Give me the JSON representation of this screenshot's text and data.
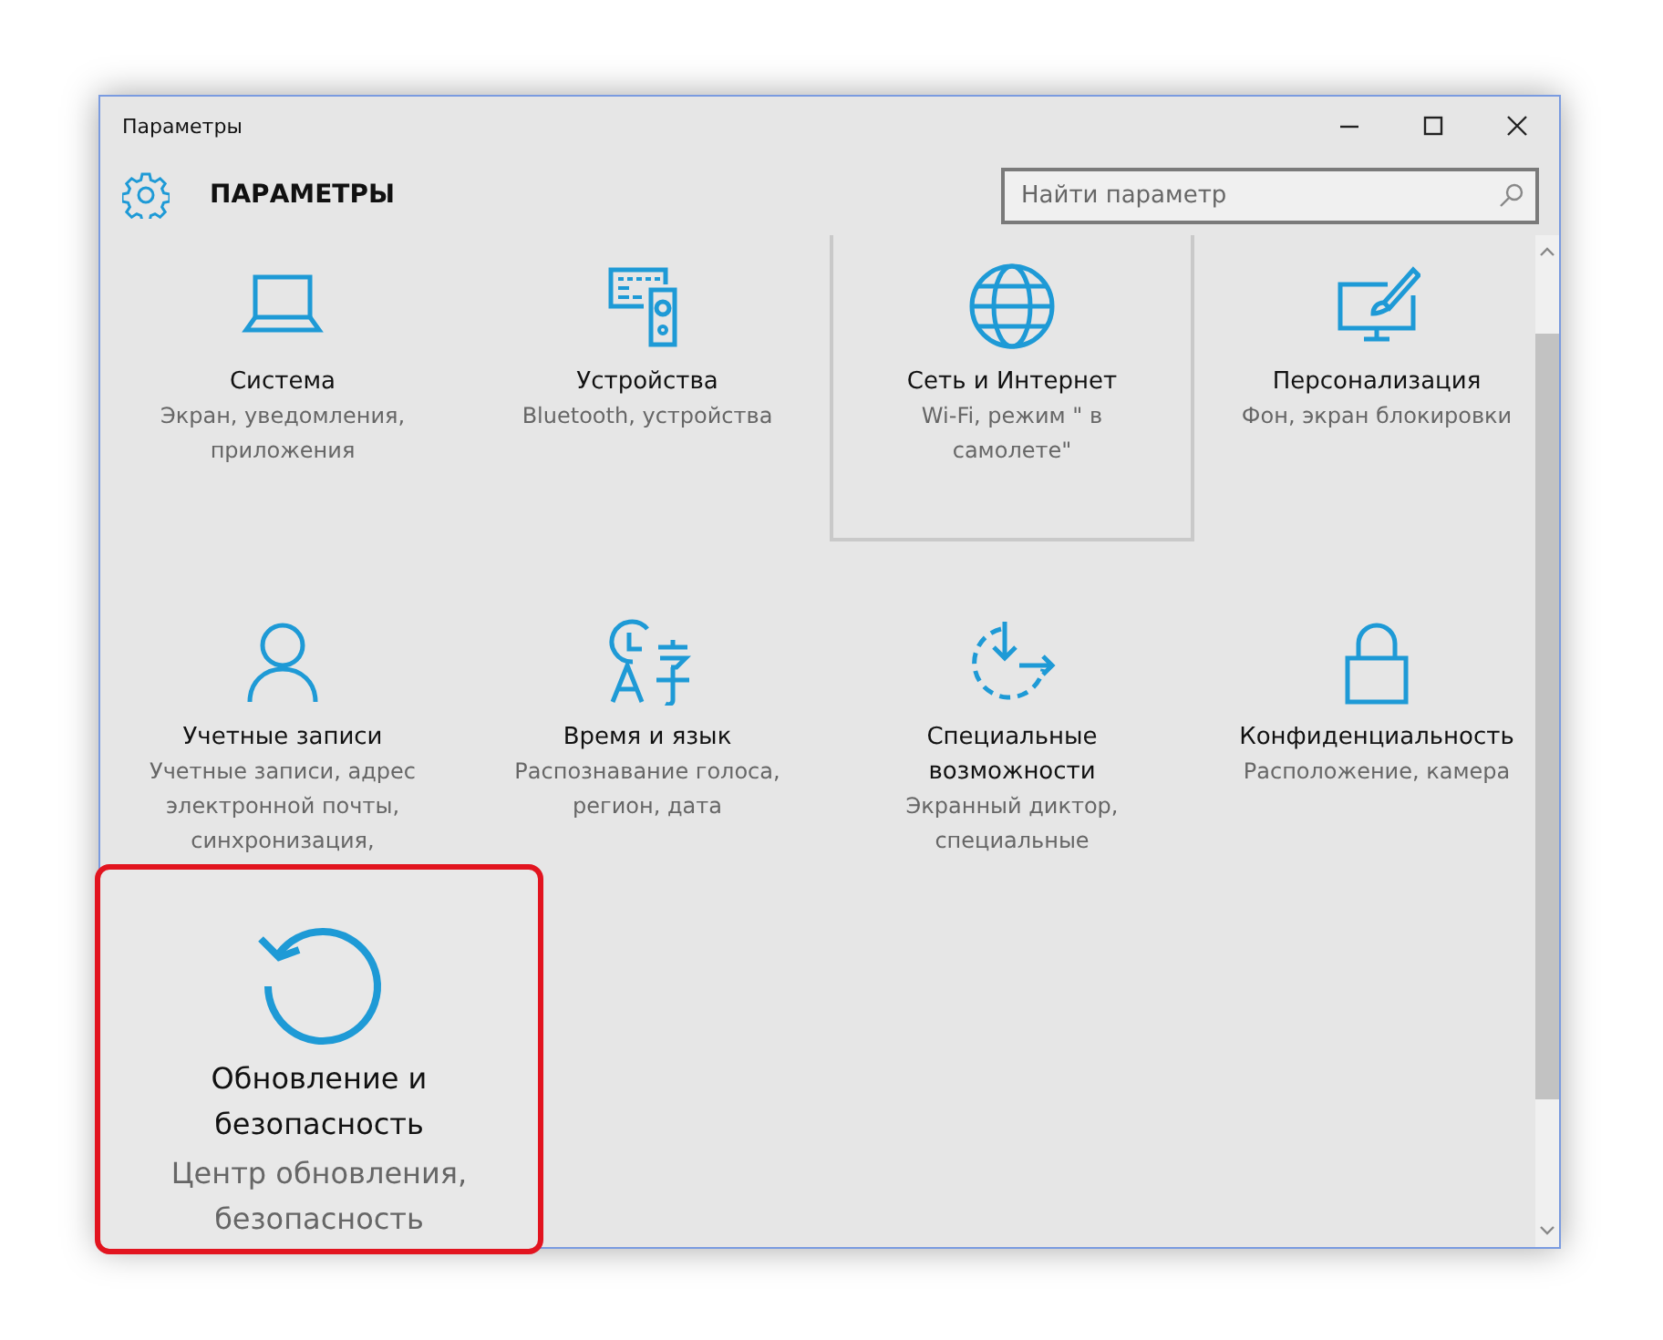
{
  "window": {
    "title": "Параметры"
  },
  "header": {
    "title": "ПАРАМЕТРЫ",
    "search": {
      "placeholder": "Найти параметр"
    }
  },
  "tiles": [
    {
      "title": "Система",
      "description": "Экран, уведомления, приложения",
      "selected": false
    },
    {
      "title": "Устройства",
      "description": "Bluetooth, устройства",
      "selected": false
    },
    {
      "title": "Сеть и Интернет",
      "description": "Wi-Fi, режим \" в самолете\"",
      "selected": true
    },
    {
      "title": "Персонализация",
      "description": "Фон, экран блокировки",
      "selected": false
    },
    {
      "title": "Учетные записи",
      "description": "Учетные записи, адрес электронной почты, синхронизация,",
      "selected": false
    },
    {
      "title": "Время и язык",
      "description": "Распознавание голоса, регион, дата",
      "selected": false
    },
    {
      "title": "Специальные возможности",
      "description": "Экранный диктор, специальные",
      "selected": false
    },
    {
      "title": "Конфиденциальность",
      "description": "Расположение, камера",
      "selected": false
    }
  ],
  "callout": {
    "title": "Обновление и безопасность",
    "description": "Центр обновления, безопасность"
  }
}
